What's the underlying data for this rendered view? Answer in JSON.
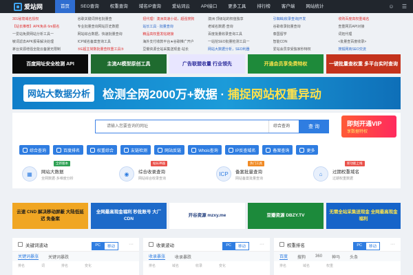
{
  "header": {
    "logo_text": "爱站网",
    "nav": [
      "首页",
      "SEO查询",
      "权重查询",
      "域名IP查询",
      "爱站词云",
      "API接口",
      "更多工具",
      "排行榜",
      "客户端",
      "网站统计"
    ],
    "active_index": 0
  },
  "links": [
    {
      "t": "301秘境域名授权",
      "c": "red"
    },
    {
      "t": "谷歌关键词排名批量查",
      "c": ""
    },
    {
      "t": "招代理！澳洲高速小说，超强搜狗",
      "c": "red"
    },
    {
      "t": "澳洲·顶级站的权值独享",
      "c": ""
    },
    {
      "t": "引蜘蛛|收录查询|开发",
      "c": "blue"
    },
    {
      "t": "收购百度高权重域名",
      "c": "red"
    },
    {
      "t": "【站长推荐】APK免杀 6m报名",
      "c": "red"
    },
    {
      "t": "专业批量查询网站历史数据",
      "c": ""
    },
    {
      "t": "站长工具 · 批量查询",
      "c": "blue"
    },
    {
      "t": "老域名数据·查询",
      "c": ""
    },
    {
      "t": "谷歌收录批量查询",
      "c": ""
    },
    {
      "t": "查重网页API对接",
      "c": ""
    },
    {
      "t": "一爱站免费网站分析工具一",
      "c": ""
    },
    {
      "t": "网站综合数据，快速批量查询",
      "c": ""
    },
    {
      "t": "精品高权重发帖链接",
      "c": "red"
    },
    {
      "t": "百度批量收录查询工具",
      "c": ""
    },
    {
      "t": "泰国留学",
      "c": ""
    },
    {
      "t": "词拓代理",
      "c": ""
    },
    {
      "t": "敏词滤去APK报毒解决处理",
      "c": ""
    },
    {
      "t": "ICP域名备案查询工具",
      "c": ""
    },
    {
      "t": "海外支付收款平台★谷歌推广开户",
      "c": ""
    },
    {
      "t": "一站挖SEO批量检测工具一",
      "c": ""
    },
    {
      "t": "智能CDN",
      "c": ""
    },
    {
      "t": "<批量查百度收录>",
      "c": ""
    },
    {
      "t": "茅台资源增强全能云备援无限制",
      "c": ""
    },
    {
      "t": "⑤E超主常数批量查权重工具⑤",
      "c": "red"
    },
    {
      "t": "豆瓣资源全站采集送现金·站长",
      "c": ""
    },
    {
      "t": "网站大数据分析，SEO利器",
      "c": "blue"
    },
    {
      "t": "爱站会员享受独家秒特权",
      "c": ""
    },
    {
      "t": "搜狐网商SEO交流",
      "c": "blue"
    }
  ],
  "ads_row1": [
    {
      "text": "百度网址安全检测 API",
      "bg": "#0b0b0b",
      "fg": "#ffffff"
    },
    {
      "text": "主流AI模型原创工具",
      "bg": "#1f6b2f",
      "fg": "#ffffff"
    },
    {
      "text": "广告联盟收量 行业领先",
      "bg": "#e8e6ff",
      "fg": "#2a2a9a"
    },
    {
      "text": "开通会员享免费特权",
      "bg": "#1e8a3a",
      "fg": "#ffe54a"
    },
    {
      "text": "一键批量查权重 多平台实时查询",
      "bg": "#c4331d",
      "fg": "#ffffff"
    }
  ],
  "banner": {
    "tag": "网站大数据分析",
    "headline": "检测全网2000万+数据 · ",
    "highlight": "捕捉网站权重异动"
  },
  "search": {
    "placeholder": "请输入您要查询的网址",
    "scope": "综合查询",
    "button": "查 询"
  },
  "vip_ad": {
    "title": "即刻开通VIP",
    "subtitle": "享数据特权"
  },
  "tools": [
    "综合查询",
    "百度排名",
    "权重综合",
    "友链检测",
    "网站反链",
    "Whois查询",
    "IP反查域名",
    "备案查询",
    "更多"
  ],
  "features": [
    {
      "title": "网站大数据",
      "sub": "全网数据·多维度分析",
      "tag": "全新版本",
      "tag_color": "#2ea154"
    },
    {
      "title": "综合收录查询",
      "sub": "网站综合收录查询",
      "tag": "站长神器",
      "tag_color": "#e9514a"
    },
    {
      "title": "备案批量查询",
      "sub": "网站备案批量查询",
      "tag": "热门工具",
      "tag_color": "#f08a24"
    },
    {
      "title": "过期权重域名",
      "sub": "过期权重数据",
      "tag": "新功能上线",
      "tag_color": "#e9514a"
    }
  ],
  "ads_row2": [
    {
      "text": "云速 CND 解决移动屏蔽 大陆低延迟 免备案",
      "bg": "#f0a623",
      "fg": "#1b1b1b"
    },
    {
      "text": "全网最高现金福利 秒批账号 大厂CDN",
      "bg": "#1d6ac9",
      "fg": "#ffffff"
    },
    {
      "text": "开谷资源 mzxy.me",
      "bg": "#ffffff",
      "fg": "#1d3a7a"
    },
    {
      "text": "豆瓣资源 DBZY.TV",
      "bg": "#1c8a3b",
      "fg": "#ffffff"
    },
    {
      "text": "无需全站采集送现金 全网最高现金福利",
      "bg": "#1664c9",
      "fg": "#ffe54a"
    }
  ],
  "panels": [
    {
      "title": "关键词波动",
      "pc": "PC",
      "mobile": "移动",
      "tabs": [
        "关键词暴涨",
        "关键词暴跌"
      ],
      "cols": [
        "排名",
        "词",
        "排名",
        "变化"
      ]
    },
    {
      "title": "收录波动",
      "pc": "PC",
      "mobile": "移动",
      "tabs": [
        "收录暴涨",
        "收录暴跌"
      ],
      "cols": [
        "排名",
        "域名",
        "收录",
        "变化"
      ]
    },
    {
      "title": "权重排名",
      "pc": "PC",
      "mobile": "移动",
      "tabs": [
        "百度",
        "搜狗",
        "360",
        "神马",
        "头条"
      ],
      "cols": [
        "排名",
        "域名",
        "权重"
      ]
    }
  ]
}
